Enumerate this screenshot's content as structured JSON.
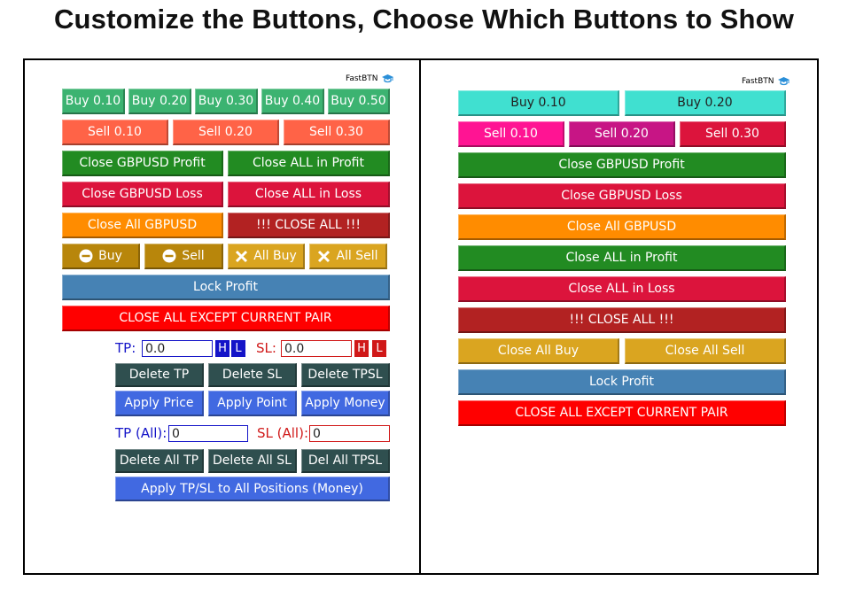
{
  "title": "Customize the Buttons, Choose Which Buttons to Show",
  "brand": "FastBTN",
  "left": {
    "buy": [
      "Buy 0.10",
      "Buy 0.20",
      "Buy 0.30",
      "Buy 0.40",
      "Buy 0.50"
    ],
    "sell": [
      "Sell 0.10",
      "Sell 0.20",
      "Sell 0.30"
    ],
    "close_profit": "Close GBPUSD Profit",
    "close_all_profit": "Close ALL in Profit",
    "close_loss": "Close GBPUSD Loss",
    "close_all_loss": "Close ALL in Loss",
    "close_all_pair": "Close All GBPUSD",
    "close_all": "!!! CLOSE ALL !!!",
    "minus_buy": "Buy",
    "minus_sell": "Sell",
    "x_all_buy": "All Buy",
    "x_all_sell": "All Sell",
    "lock_profit": "Lock Profit",
    "close_except": "CLOSE ALL EXCEPT CURRENT PAIR",
    "tp_label": "TP:",
    "tp_value": "0.0",
    "sl_label": "SL:",
    "sl_value": "0.0",
    "h": "H",
    "l": "L",
    "delete_tp": "Delete TP",
    "delete_sl": "Delete SL",
    "delete_tpsl": "Delete TPSL",
    "apply_price": "Apply Price",
    "apply_point": "Apply Point",
    "apply_money": "Apply Money",
    "tp_all_label": "TP (All):",
    "tp_all_value": "0",
    "sl_all_label": "SL (All):",
    "sl_all_value": "0",
    "delete_all_tp": "Delete All TP",
    "delete_all_sl": "Delete All SL",
    "del_all_tpsl": "Del All TPSL",
    "apply_all_money": "Apply TP/SL to All Positions (Money)"
  },
  "right": {
    "buy": [
      "Buy 0.10",
      "Buy 0.20"
    ],
    "sell": [
      "Sell 0.10",
      "Sell 0.20",
      "Sell 0.30"
    ],
    "close_profit": "Close GBPUSD Profit",
    "close_loss": "Close GBPUSD Loss",
    "close_all_pair": "Close All GBPUSD",
    "close_all_profit": "Close ALL in Profit",
    "close_all_loss": "Close ALL in Loss",
    "close_all": "!!! CLOSE ALL !!!",
    "close_all_buy": "Close All Buy",
    "close_all_sell": "Close All Sell",
    "lock_profit": "Lock Profit",
    "close_except": "CLOSE ALL EXCEPT CURRENT PAIR"
  },
  "colors": {
    "buy_left": "#3cb371",
    "sell_left": "#ff6347",
    "green": "#228b22",
    "crimson": "#dc143c",
    "orange": "#ff8c00",
    "firebrick": "#b22222",
    "goldenrod": "#b8860b",
    "gold": "#daa520",
    "steelblue": "#4682b4",
    "red": "#ff0000",
    "darkslate": "#2f4f4f",
    "royalblue": "#4169e1",
    "turquoise": "#40e0d0",
    "pink": "#ff1493",
    "violetred": "#c71585"
  }
}
